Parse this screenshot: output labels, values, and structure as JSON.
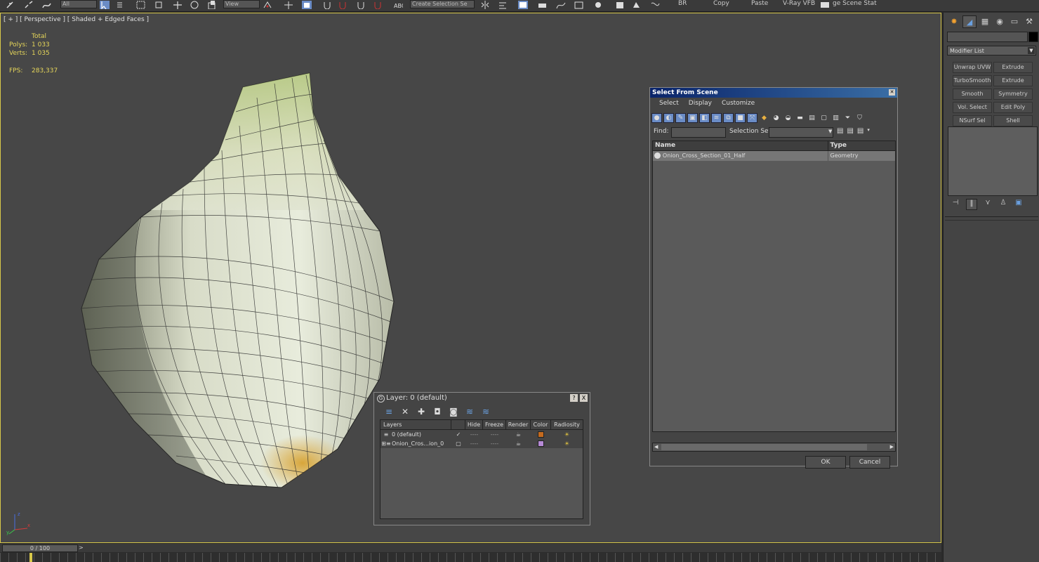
{
  "toolbar": {
    "filter_value": "All",
    "refcoord_value": "View",
    "selection_set_value": "Create Selection Se",
    "text_buttons": [
      "BR",
      "Copy",
      "Paste",
      "V-Ray VFB",
      "ge Scene Stat"
    ]
  },
  "viewport": {
    "label": "[ + ] [ Perspective ] [ Shaded + Edged Faces ]",
    "stats": {
      "total_label": "Total",
      "polys_label": "Polys:",
      "polys_value": "1 033",
      "verts_label": "Verts:",
      "verts_value": "1 035",
      "fps_label": "FPS:",
      "fps_value": "283,337"
    },
    "axis": {
      "x": "x",
      "y": "y",
      "z": "z"
    }
  },
  "timeline": {
    "frame": "0 / 100",
    "next": ">"
  },
  "command_panel": {
    "modifier_list": "Modifier List",
    "modifiers": [
      "Unwrap UVW",
      "Extrude",
      "TurboSmooth",
      "Extrude",
      "Smooth",
      "Symmetry",
      "Vol. Select",
      "Edit Poly",
      "NSurf Sel",
      "Shell"
    ]
  },
  "select_from_scene": {
    "title": "Select From Scene",
    "menu": [
      "Select",
      "Display",
      "Customize"
    ],
    "find_label": "Find:",
    "selection_set_label": "Selection Set:",
    "columns": [
      "Name",
      "Type"
    ],
    "rows": [
      {
        "name": "Onion_Cross_Section_01_Half",
        "type": "Geometry"
      }
    ],
    "ok": "OK",
    "cancel": "Cancel"
  },
  "layer_dialog": {
    "title": "Layer: 0 (default)",
    "help": "?",
    "close": "X",
    "columns": [
      "Layers",
      "Hide",
      "Freeze",
      "Render",
      "Color",
      "Radiosity"
    ],
    "rows": [
      {
        "name": "0 (default)",
        "color": "#c46a1e"
      },
      {
        "name": "Onion_Cros...ion_0",
        "color": "#b68ad6"
      }
    ]
  },
  "colors": {
    "active_border": "#d8c84a",
    "stats_text": "#e6d65a",
    "dialog_title": "#0a246a"
  }
}
